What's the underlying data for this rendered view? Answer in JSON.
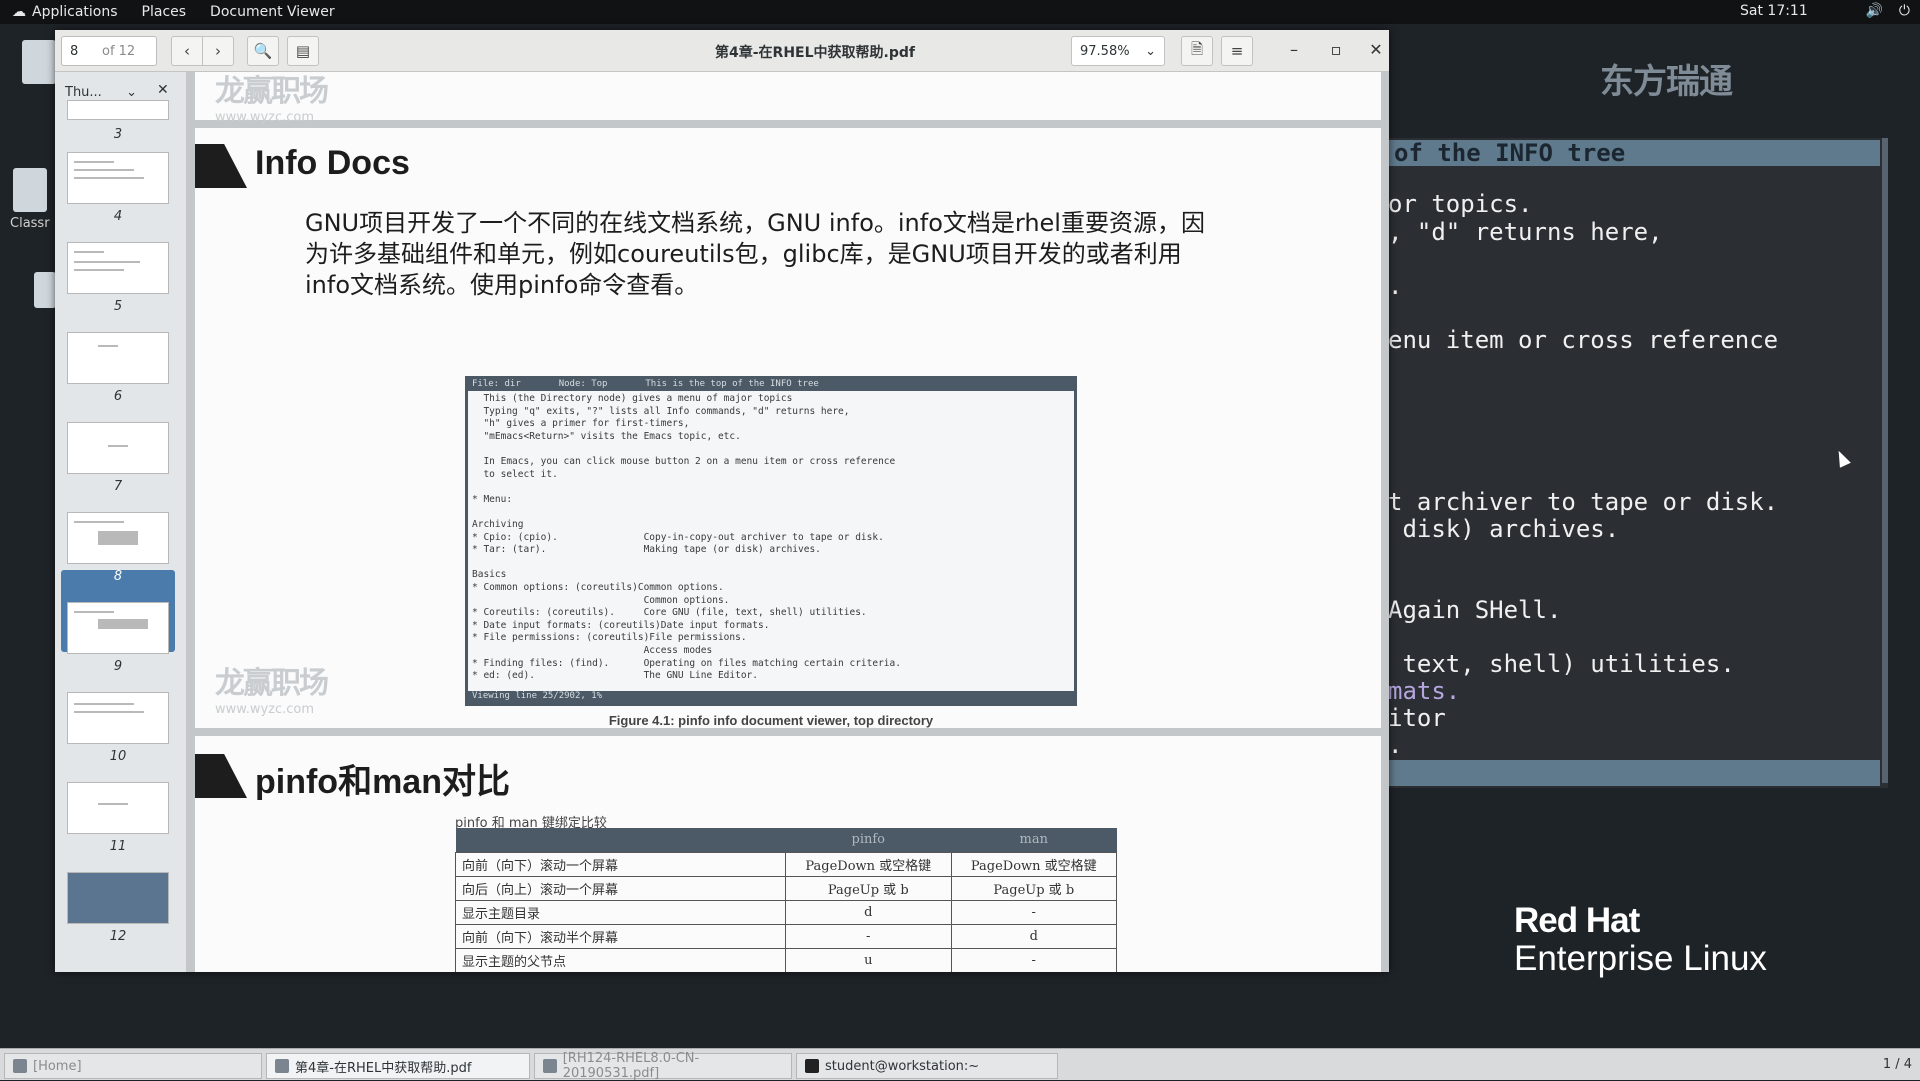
{
  "topbar": {
    "applications": "Applications",
    "places": "Places",
    "app_menu": "Document Viewer",
    "clock": "Sat 17:11"
  },
  "desktop": {
    "icons": [
      "Classr"
    ]
  },
  "terminal": {
    "header": "of the INFO tree",
    "lines": [
      "or topics.",
      ", \"d\" returns here,",
      ".",
      "enu item or cross reference",
      "t archiver to tape or disk.",
      " disk) archives.",
      "Again SHell.",
      " text, shell) utilities.",
      "mats.",
      "itor",
      "."
    ]
  },
  "branding": {
    "logo_text": "东方瑞通",
    "redhat_line1": "Red Hat",
    "redhat_line2": "Enterprise Linux"
  },
  "viewer": {
    "page_current": "8",
    "page_total": "of 12",
    "title": "第4章-在RHEL中获取帮助.pdf",
    "zoom": "97.58%",
    "sidebar_mode": "Thu...",
    "thumbnails": [
      "3",
      "4",
      "5",
      "6",
      "7",
      "8",
      "9",
      "10",
      "11",
      "12"
    ],
    "selected_thumbnail": "8"
  },
  "document": {
    "watermark": "龙赢职场",
    "watermark_url": "www.wyzc.com",
    "section1_title": "Info Docs",
    "section1_body": "GNU项目开发了一个不同的在线文档系统，GNU info。info文档是rhel重要资源，因为许多基础组件和单元，例如coureutils包，glibc库，是GNU项目开发的或者利用info文档系统。使用pinfo命令查看。",
    "figure_top": "File: dir       Node: Top       This is the top of the INFO tree",
    "figure_lines": [
      "  This (the Directory node) gives a menu of major topics",
      "  Typing \"q\" exits, \"?\" lists all Info commands, \"d\" returns here,",
      "  \"h\" gives a primer for first-timers,",
      "  \"mEmacs<Return>\" visits the Emacs topic, etc.",
      "",
      "  In Emacs, you can click mouse button 2 on a menu item or cross reference",
      "  to select it.",
      "",
      "* Menu:",
      "",
      "Archiving",
      "* Cpio: (cpio).               Copy-in-copy-out archiver to tape or disk.",
      "* Tar: (tar).                 Making tape (or disk) archives.",
      "",
      "Basics",
      "* Common options: (coreutils)Common options.",
      "                              Common options.",
      "* Coreutils: (coreutils).     Core GNU (file, text, shell) utilities.",
      "* Date input formats: (coreutils)Date input formats.",
      "* File permissions: (coreutils)File permissions.",
      "                              Access modes",
      "* Finding files: (find).      Operating on files matching certain criteria.",
      "* ed: (ed).                   The GNU Line Editor."
    ],
    "figure_bottom": "Viewing line 25/2902, 1%",
    "figure_caption": "Figure 4.1: pinfo info document viewer, top directory",
    "section2_title": "pinfo和man对比",
    "table_caption": "pinfo 和 man 键绑定比较",
    "table_headers": [
      "",
      "pinfo",
      "man"
    ],
    "table_rows": [
      [
        "向前（向下）滚动一个屏幕",
        "PageDown 或空格键",
        "PageDown 或空格键"
      ],
      [
        "向后（向上）滚动一个屏幕",
        "PageUp 或 b",
        "PageUp 或 b"
      ],
      [
        "显示主题目录",
        "d",
        "-"
      ],
      [
        "向前（向下）滚动半个屏幕",
        "-",
        "d"
      ],
      [
        "显示主题的父节点",
        "u",
        "-"
      ]
    ]
  },
  "taskbar": {
    "items": [
      "[Home]",
      "第4章-在RHEL中获取帮助.pdf",
      "[RH124-RHEL8.0-CN-20190531.pdf]",
      "student@workstation:~"
    ],
    "workspace": "1 / 4"
  }
}
